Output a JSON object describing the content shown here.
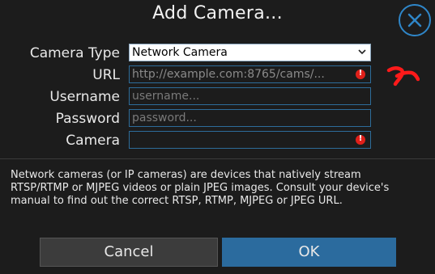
{
  "dialog": {
    "title": "Add Camera...",
    "close_icon": "close-circle-icon",
    "accent_color": "#2f86c8",
    "fields": {
      "camera_type": {
        "label": "Camera Type",
        "value": "Network Camera"
      },
      "url": {
        "label": "URL",
        "value": "http://example.com:8765/cams/..."
      },
      "username": {
        "label": "Username",
        "placeholder": "username..."
      },
      "password": {
        "label": "Password",
        "placeholder": "password..."
      },
      "camera": {
        "label": "Camera",
        "value": ""
      }
    },
    "error_icon": "error-icon",
    "error_color": "#e0201a",
    "description": "Network cameras (or IP cameras) are devices that natively stream RTSP/RTMP or MJPEG videos or plain JPEG images. Consult your device's manual to find out the correct RTSP, RTMP, MJPEG or JPEG URL.",
    "buttons": {
      "cancel": "Cancel",
      "ok": "OK"
    },
    "ok_color": "#2b6b9e"
  },
  "annotation": {
    "icon": "red-scribble-mark",
    "color": "#ff1a1a"
  }
}
